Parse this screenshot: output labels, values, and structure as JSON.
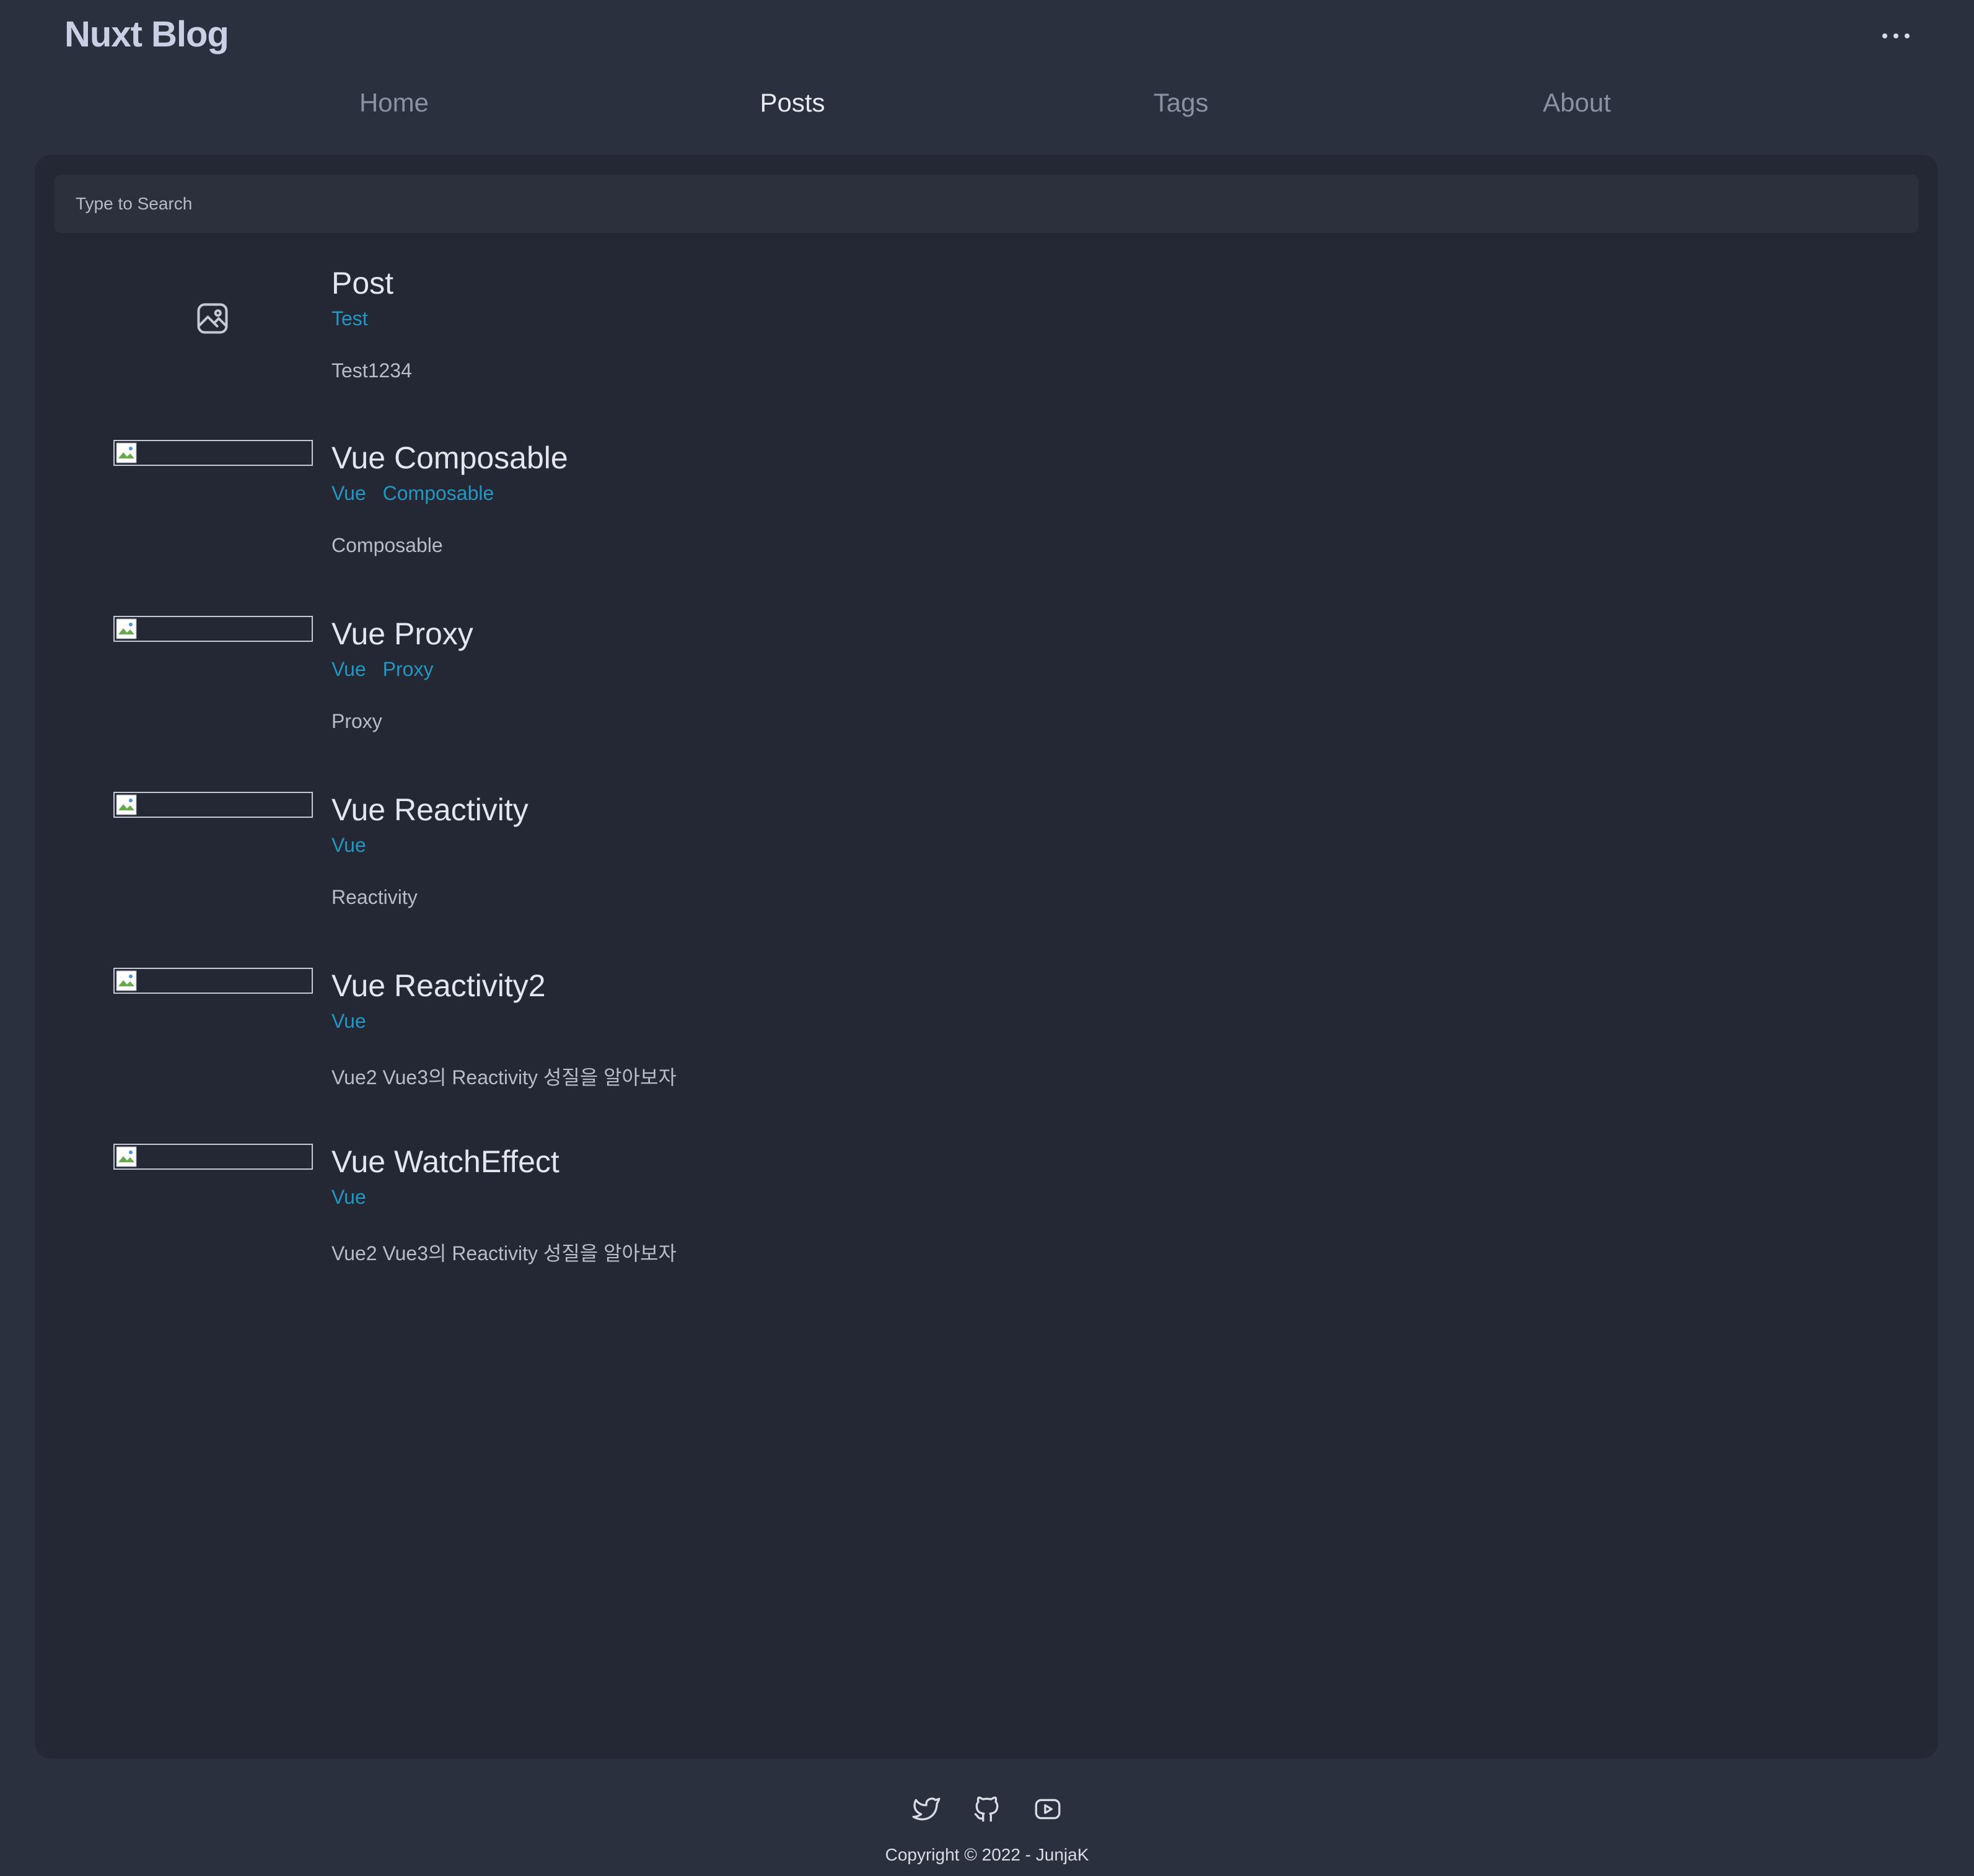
{
  "brand": "Nuxt Blog",
  "nav": [
    {
      "label": "Home",
      "active": false
    },
    {
      "label": "Posts",
      "active": true
    },
    {
      "label": "Tags",
      "active": false
    },
    {
      "label": "About",
      "active": false
    }
  ],
  "search": {
    "placeholder": "Type to Search"
  },
  "posts": [
    {
      "title": "Post",
      "tags": [
        "Test"
      ],
      "description": "Test1234",
      "image": "image-placeholder-icon"
    },
    {
      "title": "Vue Composable",
      "tags": [
        "Vue",
        "Composable"
      ],
      "description": "Composable",
      "image": "broken-image"
    },
    {
      "title": "Vue Proxy",
      "tags": [
        "Vue",
        "Proxy"
      ],
      "description": "Proxy",
      "image": "broken-image"
    },
    {
      "title": "Vue Reactivity",
      "tags": [
        "Vue"
      ],
      "description": "Reactivity",
      "image": "broken-image"
    },
    {
      "title": "Vue Reactivity2",
      "tags": [
        "Vue"
      ],
      "description": "Vue2 Vue3의 Reactivity 성질을 알아보자",
      "image": "broken-image"
    },
    {
      "title": "Vue WatchEffect",
      "tags": [
        "Vue"
      ],
      "description": "Vue2 Vue3의 Reactivity 성질을 알아보자",
      "image": "broken-image"
    }
  ],
  "footer": {
    "icons": [
      "twitter-icon",
      "github-icon",
      "youtube-icon"
    ],
    "copyright": "Copyright © 2022 - JunjaK"
  },
  "colors": {
    "background": "#2b303e",
    "panel": "#242834",
    "tag": "#2496c0",
    "title": "#e3e6ee"
  }
}
